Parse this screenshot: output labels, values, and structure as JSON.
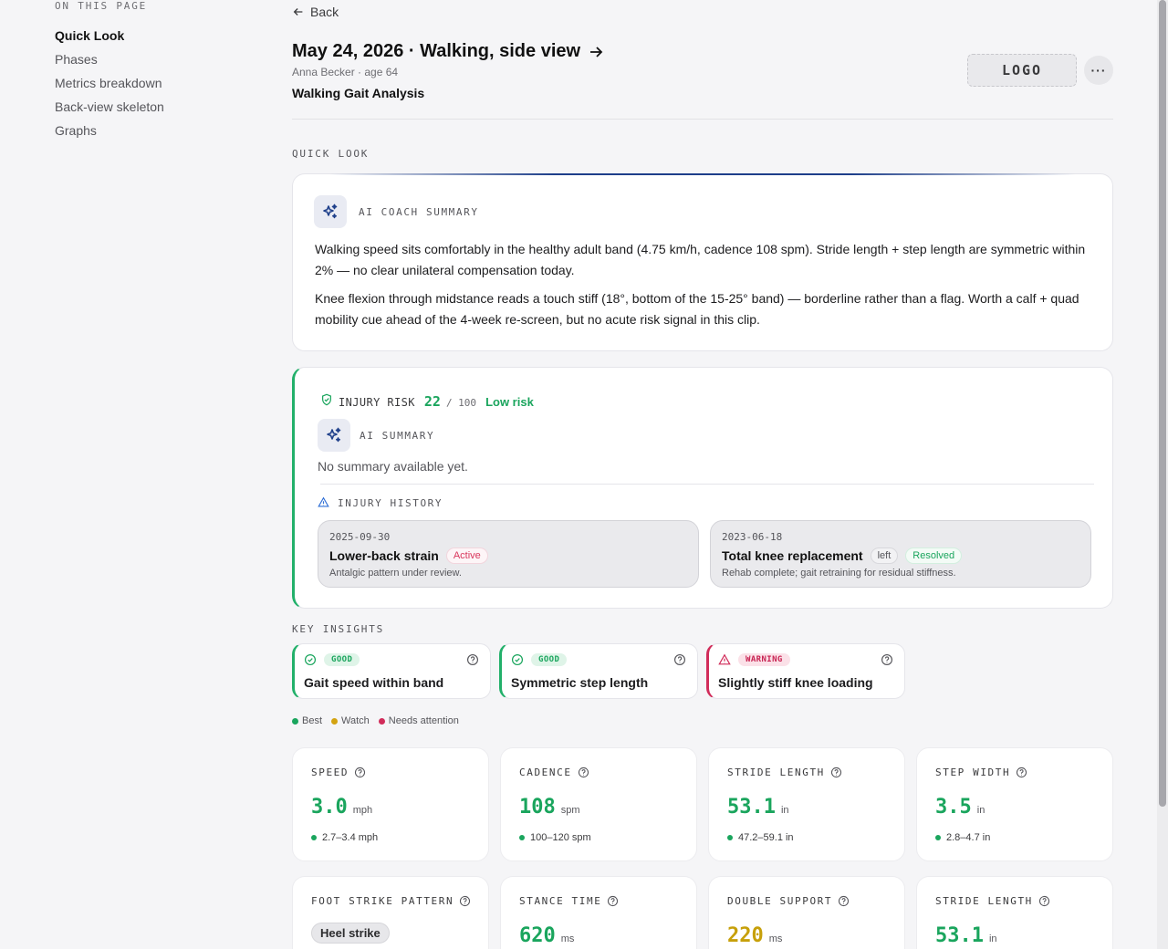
{
  "sidebar": {
    "heading": "ON THIS PAGE",
    "items": [
      {
        "label": "Quick Look"
      },
      {
        "label": "Phases"
      },
      {
        "label": "Metrics breakdown"
      },
      {
        "label": "Back-view skeleton"
      },
      {
        "label": "Graphs"
      }
    ]
  },
  "header": {
    "back_label": "Back",
    "title": "May 24, 2026 · Walking, side view",
    "subtitle": "Anna Becker · age 64",
    "report_name": "Walking Gait Analysis",
    "logo_text": "LOGO",
    "more_label": "···"
  },
  "quick_look": {
    "section_label": "QUICK LOOK",
    "coach": {
      "label": "AI COACH SUMMARY",
      "paragraphs": [
        "Walking speed sits comfortably in the healthy adult band (4.75 km/h, cadence 108 spm). Stride length + step length are symmetric within 2% — no clear unilateral compensation today.",
        "Knee flexion through midstance reads a touch stiff (18°, bottom of the 15-25° band) — borderline rather than a flag. Worth a calf + quad mobility cue ahead of the 4-week re-screen, but no acute risk signal in this clip."
      ]
    },
    "risk": {
      "label": "INJURY RISK",
      "score": "22",
      "max": "/ 100",
      "level": "Low risk",
      "ai_label": "AI SUMMARY",
      "ai_text": "No summary available yet.",
      "history_label": "INJURY HISTORY",
      "history": [
        {
          "date": "2025-09-30",
          "name": "Lower-back strain",
          "side": "",
          "status": "Active",
          "note": "Antalgic pattern under review."
        },
        {
          "date": "2023-06-18",
          "name": "Total knee replacement",
          "side": "left",
          "status": "Resolved",
          "note": "Rehab complete; gait retraining for residual stiffness."
        }
      ]
    }
  },
  "insights": {
    "label": "KEY INSIGHTS",
    "items": [
      {
        "badge": "GOOD",
        "text": "Gait speed within band",
        "kind": "good"
      },
      {
        "badge": "GOOD",
        "text": "Symmetric step length",
        "kind": "good"
      },
      {
        "badge": "WARNING",
        "text": "Slightly stiff knee loading",
        "kind": "warn"
      }
    ]
  },
  "legend": {
    "best": "Best",
    "watch": "Watch",
    "attention": "Needs attention"
  },
  "colors": {
    "good": "#1aa55d",
    "watch": "#d3a311",
    "attention": "#d12c5a",
    "accent": "#1e3f8a"
  },
  "metrics": [
    {
      "label": "SPEED",
      "value": "3.0",
      "unit": "mph",
      "range": "2.7–3.4 mph",
      "status": "good"
    },
    {
      "label": "CADENCE",
      "value": "108",
      "unit": "spm",
      "range": "100–120 spm",
      "status": "good"
    },
    {
      "label": "STRIDE LENGTH",
      "value": "53.1",
      "unit": "in",
      "range": "47.2–59.1 in",
      "status": "good"
    },
    {
      "label": "STEP WIDTH",
      "value": "3.5",
      "unit": "in",
      "range": "2.8–4.7 in",
      "status": "good"
    },
    {
      "label": "FOOT STRIKE PATTERN",
      "tag": "Heel strike"
    },
    {
      "label": "STANCE TIME",
      "value": "620",
      "unit": "ms",
      "status": "good"
    },
    {
      "label": "DOUBLE SUPPORT",
      "value": "220",
      "unit": "ms",
      "status": "watch"
    },
    {
      "label": "STRIDE LENGTH",
      "value": "53.1",
      "unit": "in",
      "status": "good"
    }
  ]
}
